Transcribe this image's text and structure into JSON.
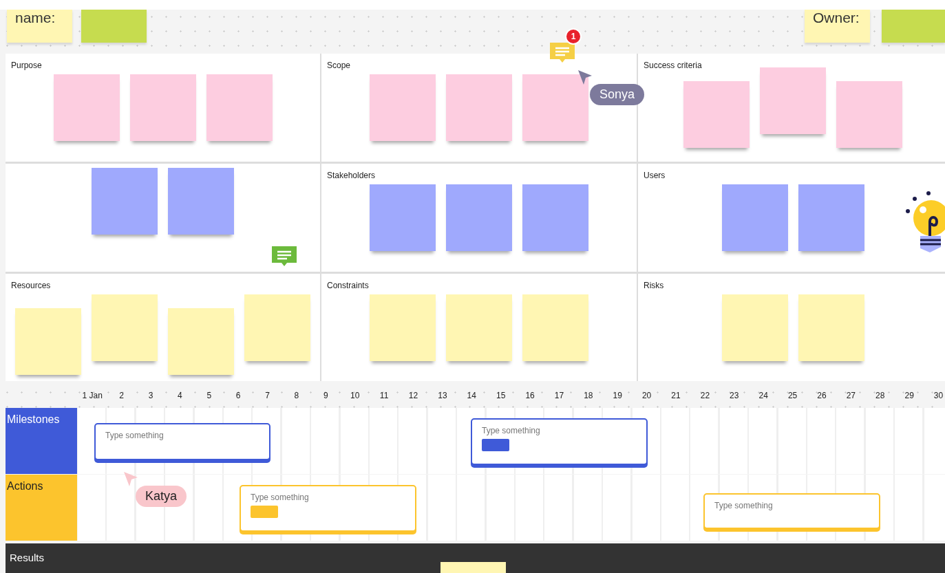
{
  "header": {
    "name_label": "name:",
    "owner_label": "Owner:"
  },
  "cells": [
    {
      "label": "Purpose",
      "notes": [
        {
          "color": "#fdcde0"
        },
        {
          "color": "#fdcde0"
        },
        {
          "color": "#fdcde0"
        }
      ]
    },
    {
      "label": "Scope",
      "notes": [
        {
          "color": "#fdcde0"
        },
        {
          "color": "#fdcde0"
        },
        {
          "color": "#fdcde0"
        }
      ]
    },
    {
      "label": "Success criteria",
      "notes": [
        {
          "color": "#fdcde0"
        },
        {
          "color": "#fdcde0"
        },
        {
          "color": "#fdcde0"
        }
      ]
    },
    {
      "notes": [
        {
          "color": "#9fa9fd"
        },
        {
          "color": "#9fa9fd"
        }
      ]
    },
    {
      "label": "Stakeholders",
      "notes": [
        {
          "color": "#9fa9fd"
        },
        {
          "color": "#9fa9fd"
        },
        {
          "color": "#9fa9fd"
        }
      ]
    },
    {
      "label": "Users",
      "notes": [
        {
          "color": "#9fa9fd"
        },
        {
          "color": "#9fa9fd"
        }
      ]
    },
    {
      "label": "Resources",
      "notes": [
        {
          "color": "#fff6b3"
        },
        {
          "color": "#fff6b3"
        },
        {
          "color": "#fff6b3"
        },
        {
          "color": "#fff6b3"
        }
      ]
    },
    {
      "label": "Constraints",
      "notes": [
        {
          "color": "#fff6b3"
        },
        {
          "color": "#fff6b3"
        },
        {
          "color": "#fff6b3"
        }
      ]
    },
    {
      "label": "Risks",
      "notes": [
        {
          "color": "#fff6b3"
        },
        {
          "color": "#fff6b3"
        }
      ]
    }
  ],
  "timeline": {
    "days": [
      "1 Jan",
      "2",
      "3",
      "4",
      "5",
      "6",
      "7",
      "8",
      "9",
      "10",
      "11",
      "12",
      "13",
      "14",
      "15",
      "16",
      "17",
      "18",
      "19",
      "20",
      "21",
      "22",
      "23",
      "24",
      "25",
      "26",
      "27",
      "28",
      "29",
      "30"
    ],
    "rows": [
      {
        "label": "Milestones",
        "color": "#3f5ad8",
        "cards": [
          {
            "text": "Type something",
            "tag": false
          },
          {
            "text": "Type something",
            "tag": true
          }
        ]
      },
      {
        "label": "Actions",
        "color": "#fcc42d",
        "cards": [
          {
            "text": "Type something",
            "tag": true
          },
          {
            "text": "Type something",
            "tag": false
          }
        ]
      }
    ]
  },
  "results": {
    "label": "Results"
  },
  "comments": [
    {
      "color": "#f5cf45",
      "badge": "1"
    },
    {
      "color": "#6cba3c"
    }
  ],
  "cursors": [
    {
      "name": "Sonya",
      "color": "#7d7a9c"
    },
    {
      "name": "Katya",
      "color": "#f9c6cb"
    }
  ]
}
